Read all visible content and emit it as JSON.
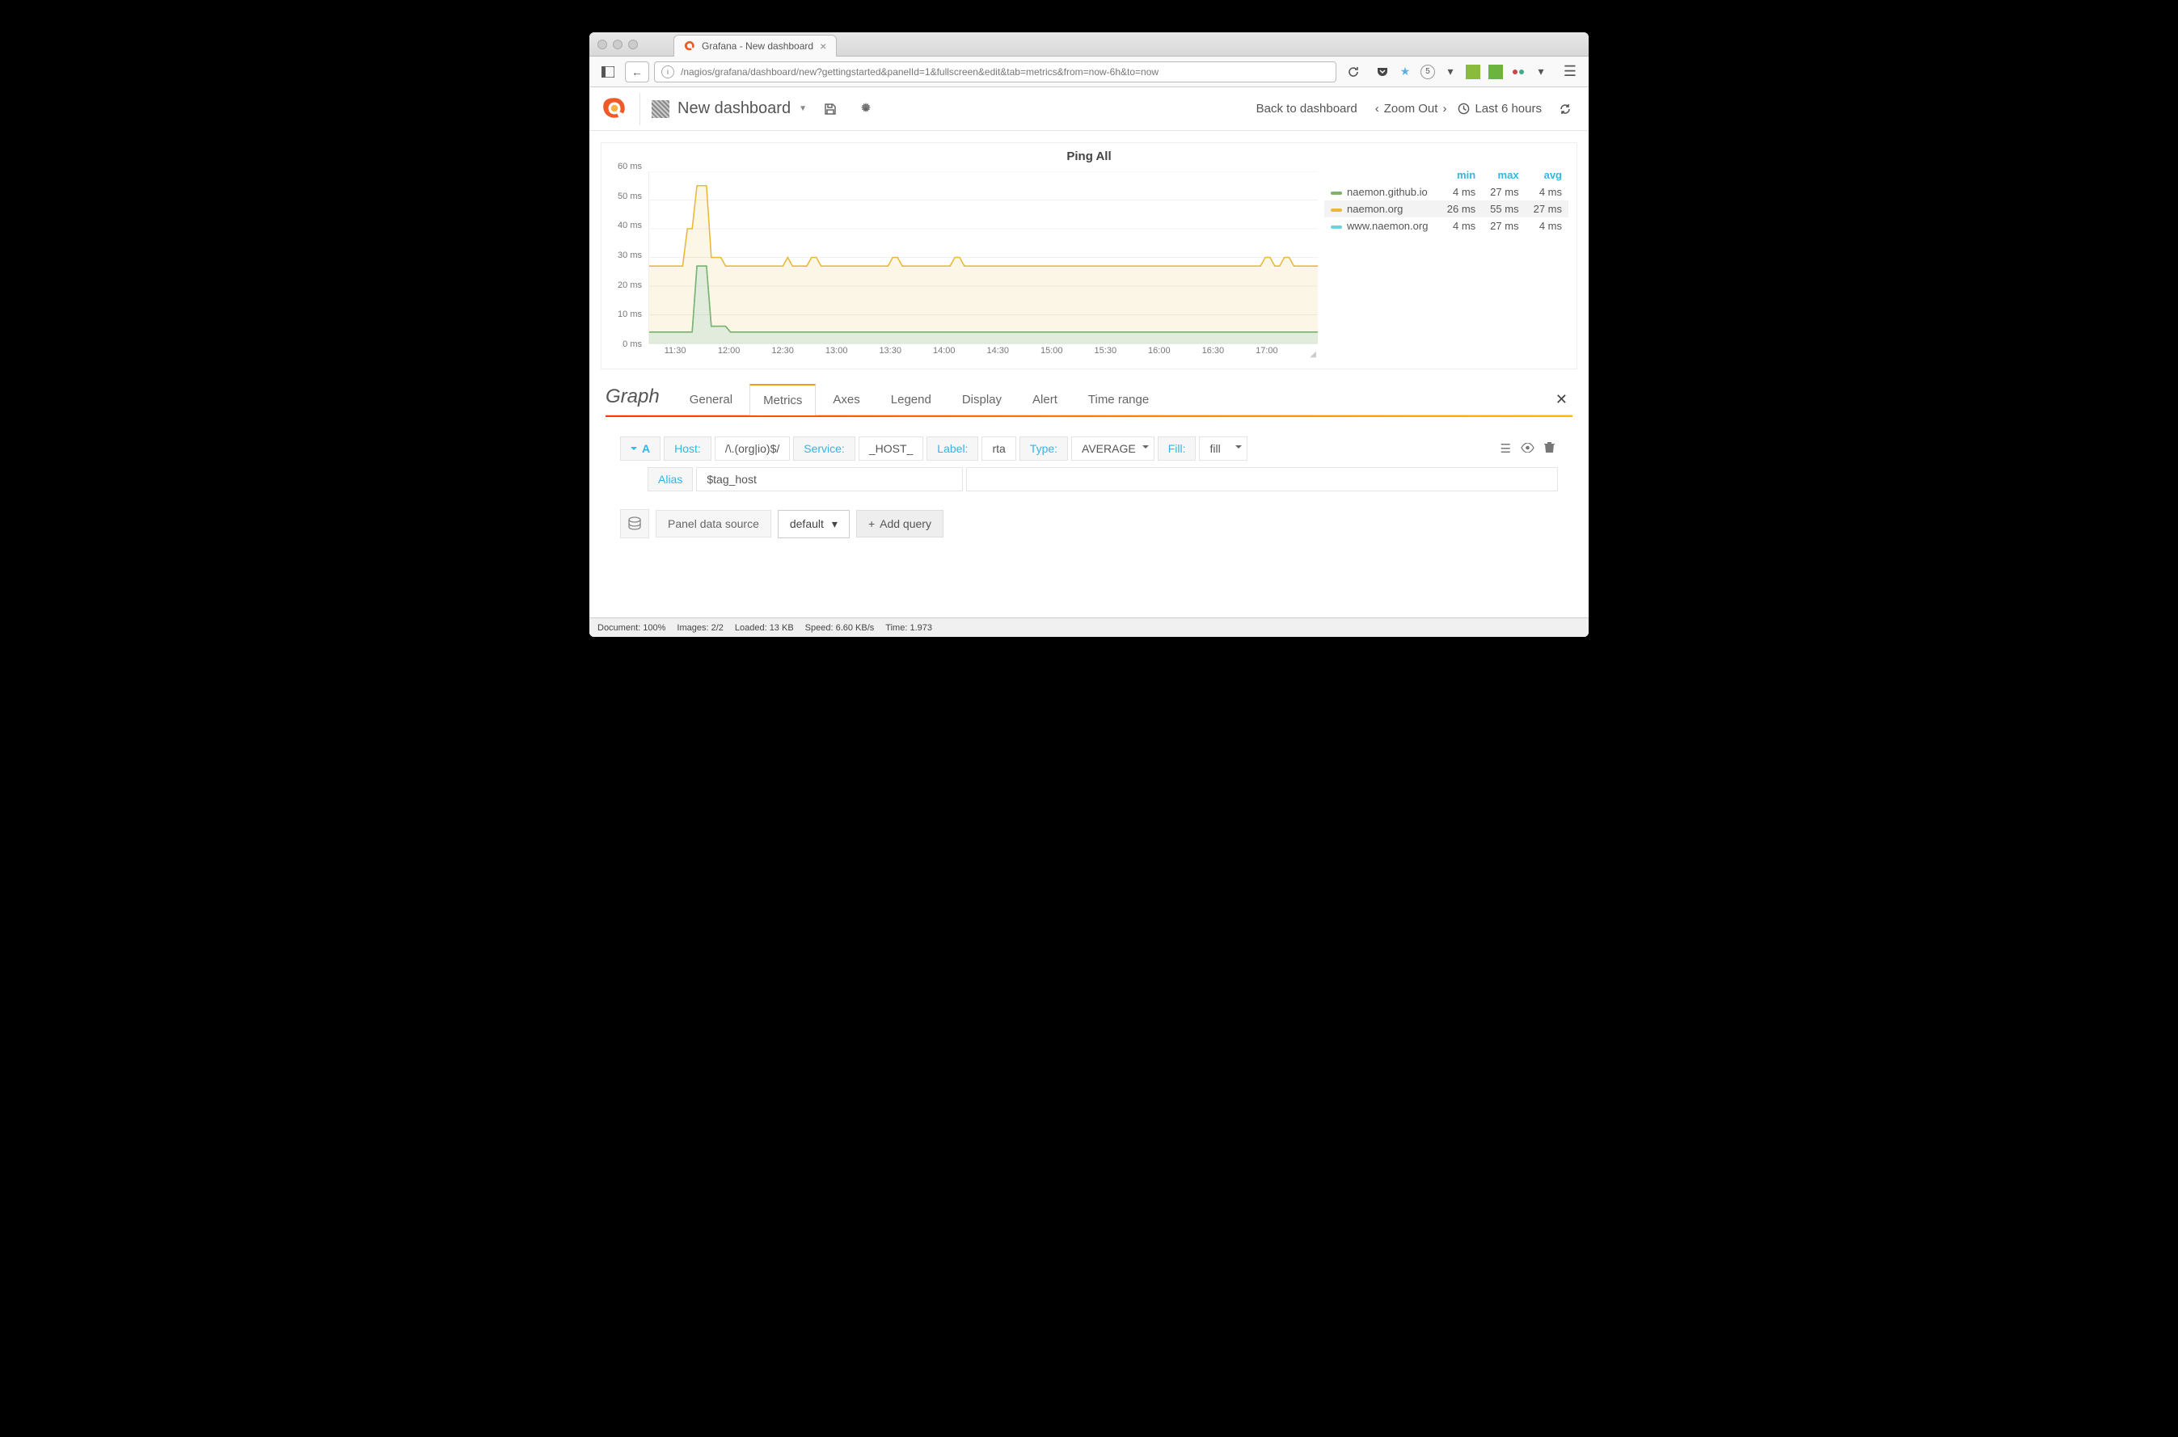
{
  "browser": {
    "tab_title": "Grafana - New dashboard",
    "url": "/nagios/grafana/dashboard/new?gettingstarted&panelId=1&fullscreen&edit&tab=metrics&from=now-6h&to=now",
    "badge": "5"
  },
  "header": {
    "dashboard_name": "New dashboard",
    "back_link": "Back to dashboard",
    "zoom": "Zoom Out",
    "time_range": "Last 6 hours"
  },
  "panel": {
    "title": "Ping All",
    "legend": {
      "cols": [
        "min",
        "max",
        "avg"
      ],
      "rows": [
        {
          "color": "#7eb26d",
          "name": "naemon.github.io",
          "min": "4 ms",
          "max": "27 ms",
          "avg": "4 ms",
          "highlight": false
        },
        {
          "color": "#eab839",
          "name": "naemon.org",
          "min": "26 ms",
          "max": "55 ms",
          "avg": "27 ms",
          "highlight": true
        },
        {
          "color": "#6ed0e0",
          "name": "www.naemon.org",
          "min": "4 ms",
          "max": "27 ms",
          "avg": "4 ms",
          "highlight": false
        }
      ]
    }
  },
  "chart_data": {
    "type": "line",
    "title": "Ping All",
    "ylabel": "",
    "xlabel": "",
    "ylim": [
      0,
      60
    ],
    "yticks": [
      "0 ms",
      "10 ms",
      "20 ms",
      "30 ms",
      "40 ms",
      "50 ms",
      "60 ms"
    ],
    "xticks": [
      "11:30",
      "12:00",
      "12:30",
      "13:00",
      "13:30",
      "14:00",
      "14:30",
      "15:00",
      "15:30",
      "16:00",
      "16:30",
      "17:00"
    ],
    "series": [
      {
        "name": "naemon.org",
        "color": "#eab839",
        "fill": "rgba(234,184,57,0.12)",
        "values_approx": "steady ~27 with spike to 55 near 11:45 and small bumps to ~30"
      },
      {
        "name": "naemon.github.io",
        "color": "#7eb26d",
        "fill": "rgba(126,178,109,0.12)",
        "values_approx": "steady ~4 with spike to 27 near 11:45"
      },
      {
        "name": "www.naemon.org",
        "color": "#6ed0e0",
        "fill": "rgba(110,208,224,0.12)",
        "values_approx": "steady ~4 with spike to 27 near 11:45"
      }
    ]
  },
  "editor": {
    "title": "Graph",
    "tabs": [
      "General",
      "Metrics",
      "Axes",
      "Legend",
      "Display",
      "Alert",
      "Time range"
    ],
    "active_tab": "Metrics",
    "query": {
      "letter": "A",
      "host_label": "Host:",
      "host_value": "/\\.(org|io)$/",
      "service_label": "Service:",
      "service_value": "_HOST_",
      "label_label": "Label:",
      "label_value": "rta",
      "type_label": "Type:",
      "type_value": "AVERAGE",
      "fill_label": "Fill:",
      "fill_value": "fill",
      "alias_label": "Alias",
      "alias_value": "$tag_host"
    },
    "datasource": {
      "label": "Panel data source",
      "value": "default",
      "add_query": "Add query"
    }
  },
  "statusbar": {
    "document": "Document: 100%",
    "images": "Images: 2/2",
    "loaded": "Loaded: 13 KB",
    "speed": "Speed: 6.60 KB/s",
    "time": "Time: 1.973"
  }
}
